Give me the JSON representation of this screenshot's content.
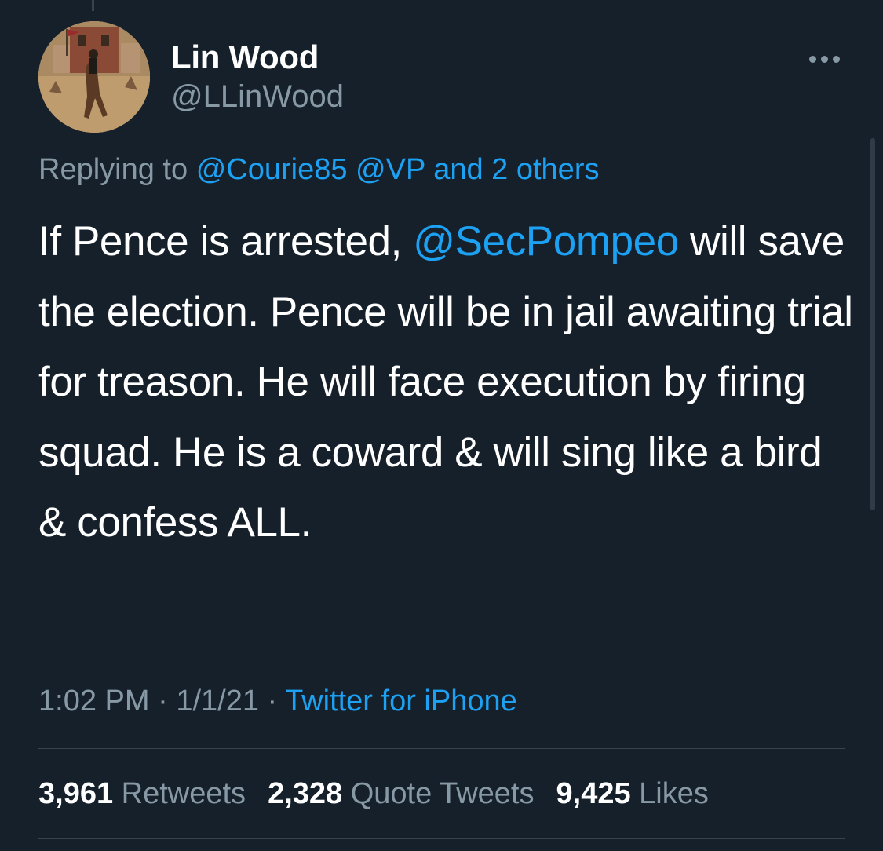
{
  "author": {
    "display_name": "Lin Wood",
    "handle": "@LLinWood",
    "avatar": "horse-rider-painting"
  },
  "reply_context": {
    "prefix": "Replying to",
    "mentions": [
      "@Courie85",
      "@VP"
    ],
    "others": "and 2 others"
  },
  "tweet": {
    "text_before": "If Pence is arrested, ",
    "mention": "@SecPompeo",
    "text_after": " will save the election. Pence will be in jail awaiting trial for treason. He will face execution by firing squad. He is a coward & will sing like a bird & confess ALL."
  },
  "meta": {
    "time": "1:02 PM",
    "separator": "·",
    "date": "1/1/21",
    "source": "Twitter for iPhone"
  },
  "stats": {
    "retweets_count": "3,961",
    "retweets_label": "Retweets",
    "quotes_count": "2,328",
    "quotes_label": "Quote Tweets",
    "likes_count": "9,425",
    "likes_label": "Likes"
  },
  "icons": {
    "more": "more-horizontal-icon"
  },
  "colors": {
    "background": "#15202b",
    "link": "#1da1f2",
    "secondary_text": "#8899a6",
    "divider": "#38444d"
  }
}
